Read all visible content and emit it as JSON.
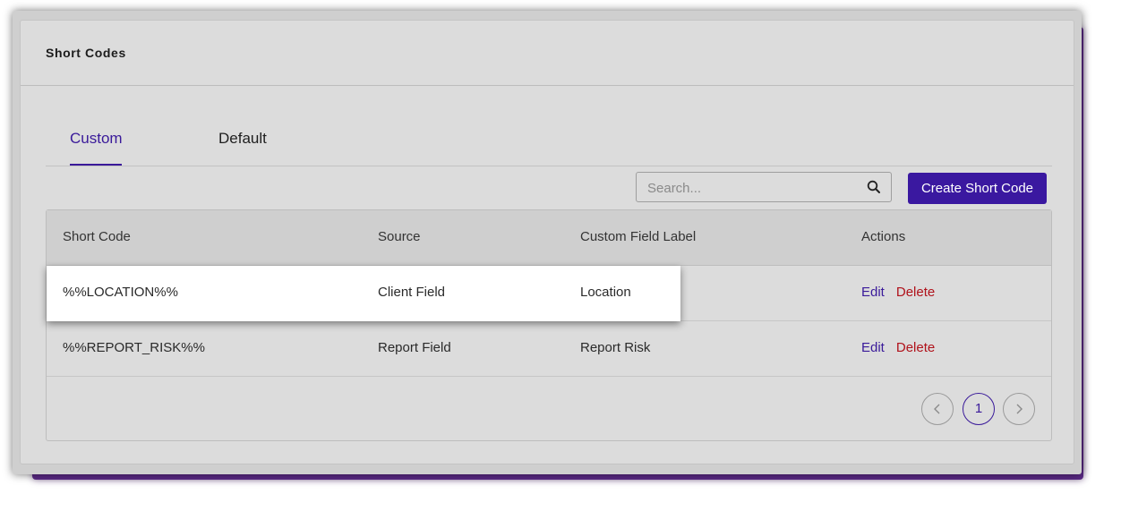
{
  "card": {
    "title": "Short Codes"
  },
  "tabs": [
    {
      "label": "Custom",
      "active": true
    },
    {
      "label": "Default",
      "active": false
    }
  ],
  "search": {
    "placeholder": "Search...",
    "value": "",
    "icon": "search-icon"
  },
  "create_button": {
    "label": "Create Short Code",
    "color": "#3a18a0"
  },
  "table": {
    "headers": [
      "Short Code",
      "Source",
      "Custom Field Label",
      "Actions"
    ],
    "rows": [
      {
        "short_code": "%%LOCATION%%",
        "source": "Client Field",
        "label": "Location",
        "edit": "Edit",
        "delete": "Delete",
        "highlighted": true
      },
      {
        "short_code": "%%REPORT_RISK%%",
        "source": "Report Field",
        "label": "Report Risk",
        "edit": "Edit",
        "delete": "Delete",
        "highlighted": false
      }
    ]
  },
  "pagination": {
    "prev_icon": "chevron-left-icon",
    "current_page": "1",
    "next_icon": "chevron-right-icon"
  },
  "colors": {
    "accent": "#3a1a9a",
    "delete": "#b0121b",
    "backdrop_shadow": "#5b2a86"
  }
}
